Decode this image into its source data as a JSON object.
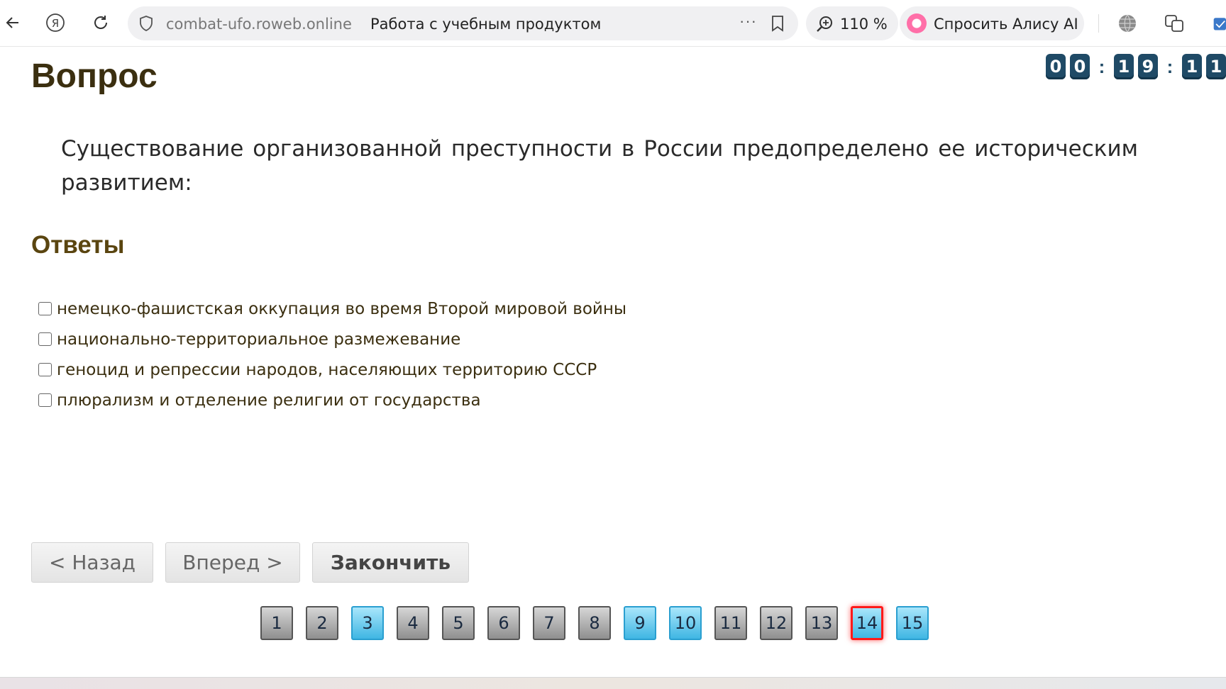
{
  "browser": {
    "domain": "combat-ufo.roweb.online",
    "page_title": "Работа с учебным продуктом",
    "more_label": "···",
    "zoom": "110 %",
    "alice_label": "Спросить Алису AI",
    "yandex_label": "Я"
  },
  "page": {
    "heading": "Вопрос",
    "timer": [
      "0",
      "0",
      ":",
      "1",
      "9",
      ":",
      "1",
      "1"
    ],
    "question": "Существование организованной преступности в России предопределено ее историческим развитием:",
    "answers_heading": "Ответы",
    "answers": [
      {
        "text": "немецко-фашистская оккупация во время Второй мировой войны",
        "checked": false
      },
      {
        "text": "национально-территориальное размежевание",
        "checked": false
      },
      {
        "text": "геноцид и репрессии народов, населяющих территорию СССР",
        "checked": false
      },
      {
        "text": "плюрализм и отделение религии от государства",
        "checked": false
      }
    ],
    "buttons": {
      "back": "< Назад",
      "forward": "Вперед >",
      "finish": "Закончить"
    },
    "pages": [
      {
        "label": "1",
        "state": "grey"
      },
      {
        "label": "2",
        "state": "grey"
      },
      {
        "label": "3",
        "state": "blue"
      },
      {
        "label": "4",
        "state": "grey"
      },
      {
        "label": "5",
        "state": "grey"
      },
      {
        "label": "6",
        "state": "grey"
      },
      {
        "label": "7",
        "state": "grey"
      },
      {
        "label": "8",
        "state": "grey"
      },
      {
        "label": "9",
        "state": "blue"
      },
      {
        "label": "10",
        "state": "blue"
      },
      {
        "label": "11",
        "state": "grey"
      },
      {
        "label": "12",
        "state": "grey"
      },
      {
        "label": "13",
        "state": "grey"
      },
      {
        "label": "14",
        "state": "current"
      },
      {
        "label": "15",
        "state": "blue"
      }
    ]
  },
  "colors": {
    "heading": "#3b2f10",
    "answers_heading": "#5a4510",
    "timer_digit": "#1f4a66",
    "page_grey": "#8f8f8f",
    "page_blue": "#3fb6e3",
    "page_current_border": "#ff1a1a"
  }
}
